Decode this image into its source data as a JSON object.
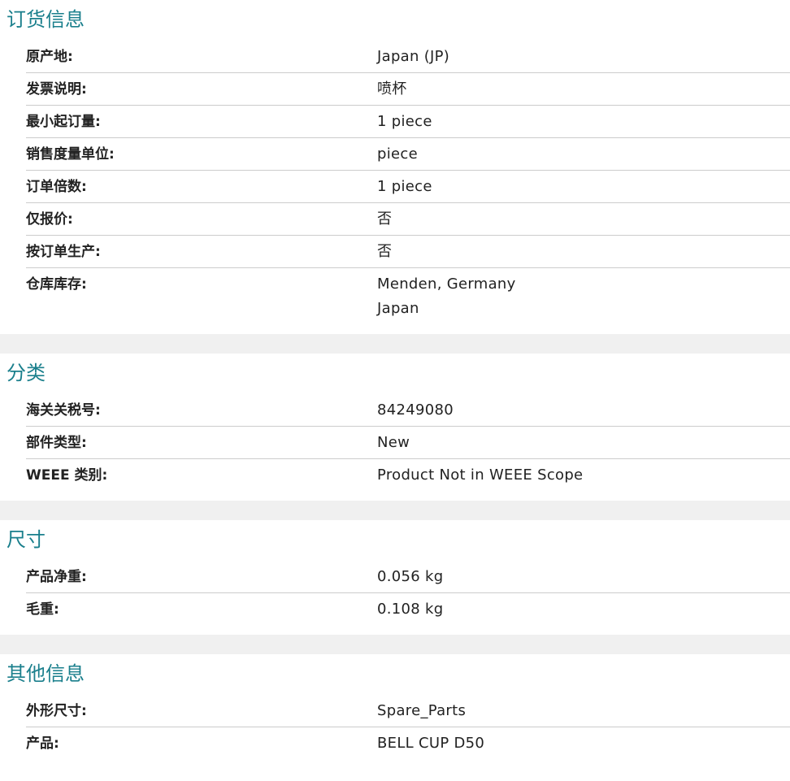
{
  "sections": [
    {
      "title": "订货信息",
      "rows": [
        {
          "label": "原产地:",
          "values": [
            "Japan (JP)"
          ]
        },
        {
          "label": "发票说明:",
          "values": [
            "喷杯"
          ]
        },
        {
          "label": "最小起订量:",
          "values": [
            "1 piece"
          ]
        },
        {
          "label": "销售度量单位:",
          "values": [
            "piece"
          ]
        },
        {
          "label": "订单倍数:",
          "values": [
            "1 piece"
          ]
        },
        {
          "label": "仅报价:",
          "values": [
            "否"
          ]
        },
        {
          "label": "按订单生产:",
          "values": [
            "否"
          ]
        },
        {
          "label": "仓库库存:",
          "values": [
            "Menden, Germany",
            "Japan"
          ]
        }
      ]
    },
    {
      "title": "分类",
      "rows": [
        {
          "label": "海关关税号:",
          "values": [
            "84249080"
          ]
        },
        {
          "label": "部件类型:",
          "values": [
            "New"
          ]
        },
        {
          "label": "WEEE 类别:",
          "values": [
            "Product Not in WEEE Scope"
          ]
        }
      ]
    },
    {
      "title": "尺寸",
      "rows": [
        {
          "label": "产品净重:",
          "values": [
            "0.056 kg"
          ]
        },
        {
          "label": "毛重:",
          "values": [
            "0.108 kg"
          ]
        }
      ]
    },
    {
      "title": "其他信息",
      "rows": [
        {
          "label": "外形尺寸:",
          "values": [
            "Spare_Parts"
          ]
        },
        {
          "label": "产品:",
          "values": [
            "BELL CUP D50"
          ]
        }
      ]
    }
  ],
  "colors": {
    "title": "#1a7f8c",
    "divider": "#cccccc",
    "gap": "#f0f0f0"
  }
}
